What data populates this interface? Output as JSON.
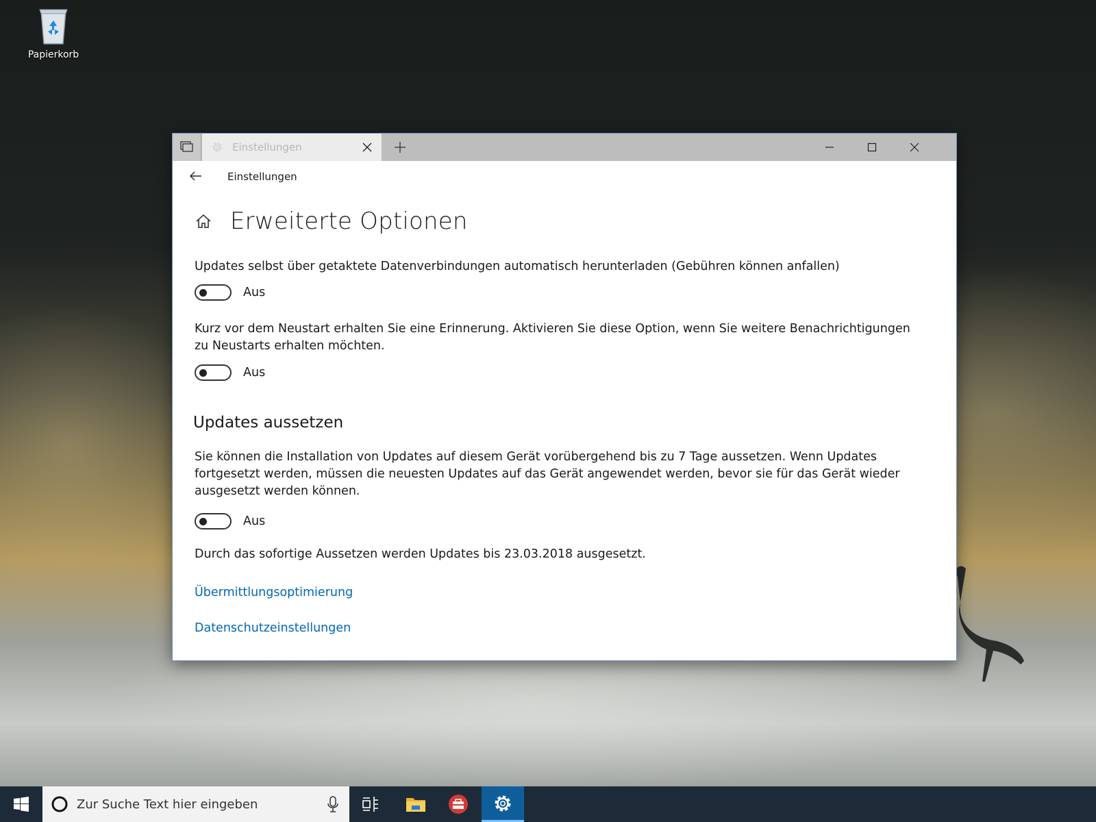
{
  "desktop": {
    "icons": [
      {
        "label": "Papierkorb",
        "icon": "recycle-bin-icon"
      }
    ]
  },
  "window": {
    "tab_title": "Einstellungen",
    "nav_title": "Einstellungen",
    "page_title": "Erweiterte Optionen",
    "settings": [
      {
        "text": "Updates selbst über getaktete Datenverbindungen automatisch herunterladen (Gebühren können anfallen)",
        "state_label": "Aus",
        "on": false
      },
      {
        "text": "Kurz vor dem Neustart erhalten Sie eine Erinnerung. Aktivieren Sie diese Option, wenn Sie weitere Benachrichtigungen zu Neustarts erhalten möchten.",
        "state_label": "Aus",
        "on": false
      }
    ],
    "pause_section": {
      "heading": "Updates aussetzen",
      "description": "Sie können die Installation von Updates auf diesem Gerät vorübergehend bis zu 7 Tage aussetzen. Wenn Updates fortgesetzt werden, müssen die neuesten Updates auf das Gerät angewendet werden, bevor sie für das Gerät wieder ausgesetzt werden können.",
      "state_label": "Aus",
      "on": false,
      "note": "Durch das sofortige Aussetzen werden Updates bis 23.03.2018 ausgesetzt."
    },
    "links": [
      "Übermittlungsoptimierung",
      "Datenschutzeinstellungen"
    ]
  },
  "taskbar": {
    "search_placeholder": "Zur Suche Text hier eingeben",
    "pinned": [
      "task-view-icon",
      "file-explorer-icon",
      "toolbox-icon",
      "settings-gear-icon"
    ],
    "active": "settings-gear-icon"
  },
  "colors": {
    "accent": "#0067b8",
    "taskbar": "#1d2b38",
    "active_app": "#0f5e9c"
  }
}
